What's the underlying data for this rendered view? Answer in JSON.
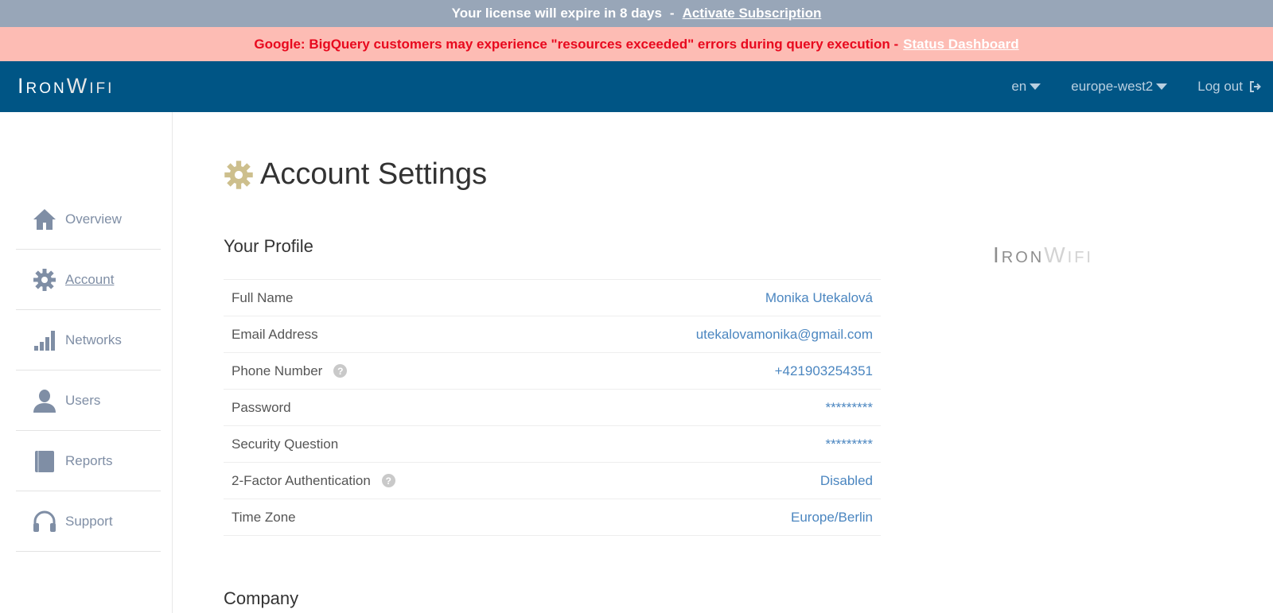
{
  "license": {
    "text": "Your license will expire in 8 days",
    "separator": "-",
    "link": "Activate Subscription"
  },
  "alert": {
    "text": "Google: BigQuery customers may experience \"resources exceeded\" errors during query execution -",
    "link": "Status Dashboard"
  },
  "brand": {
    "iron": "Iron",
    "wifi": "Wifi"
  },
  "topnav": {
    "language": "en",
    "region": "europe-west2",
    "logout": "Log out"
  },
  "sidebar": {
    "items": [
      {
        "label": "Overview",
        "icon": "home-icon"
      },
      {
        "label": "Account",
        "icon": "gear-icon",
        "active": true
      },
      {
        "label": "Networks",
        "icon": "signal-bars-icon"
      },
      {
        "label": "Users",
        "icon": "user-icon"
      },
      {
        "label": "Reports",
        "icon": "book-icon"
      },
      {
        "label": "Support",
        "icon": "headset-icon"
      }
    ]
  },
  "page": {
    "title": "Account Settings"
  },
  "profile": {
    "title": "Your Profile",
    "rows": [
      {
        "label": "Full Name",
        "value": "Monika Utekalová"
      },
      {
        "label": "Email Address",
        "value": "utekalovamonika@gmail.com"
      },
      {
        "label": "Phone Number",
        "value": "+421903254351",
        "help": "?"
      },
      {
        "label": "Password",
        "value": "*********"
      },
      {
        "label": "Security Question",
        "value": "*********"
      },
      {
        "label": "2-Factor Authentication",
        "value": "Disabled",
        "help": "?"
      },
      {
        "label": "Time Zone",
        "value": "Europe/Berlin"
      }
    ]
  },
  "company": {
    "title": "Company"
  },
  "colors": {
    "topnav": "#005585",
    "license_bar": "#98a6b8",
    "alert_bar": "#fdbcb4",
    "alert_text": "#e8091e",
    "link_value": "#4b86c0",
    "gear_gold": "#cdbf8d"
  }
}
